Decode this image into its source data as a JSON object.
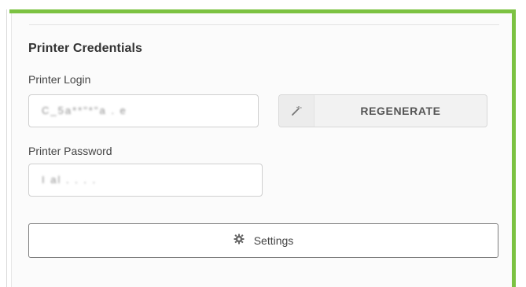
{
  "panel": {
    "title": "Printer Credentials"
  },
  "login": {
    "label": "Printer Login",
    "value": "C_5a**\"*\"a . e"
  },
  "password": {
    "label": "Printer Password",
    "value": "I al . . . ."
  },
  "regenerate": {
    "label": "REGENERATE",
    "icon": "magic-wand-icon"
  },
  "settings": {
    "label": "Settings",
    "icon": "gear-icon"
  },
  "colors": {
    "highlight": "#7cc242",
    "panel_bg": "#fbfbfb"
  }
}
